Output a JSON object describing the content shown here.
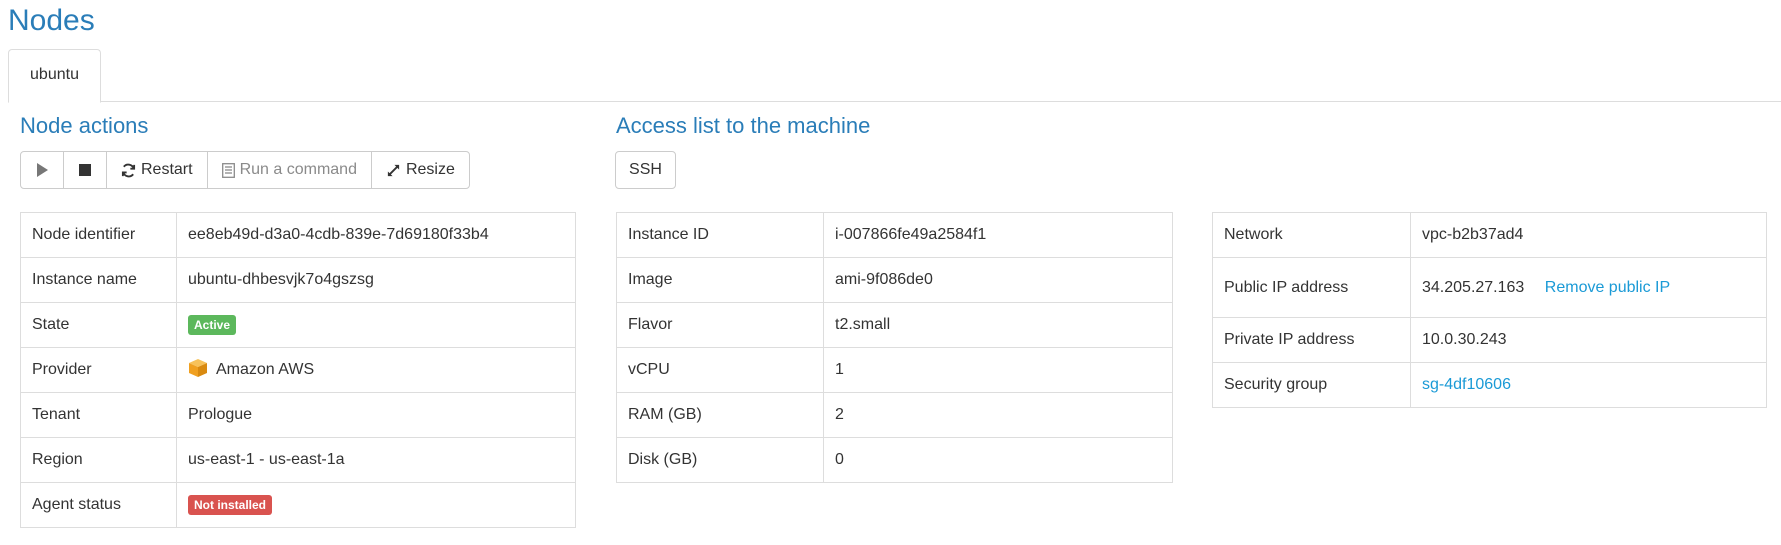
{
  "page": {
    "title": "Nodes"
  },
  "tabs": [
    {
      "label": "ubuntu"
    }
  ],
  "node_actions": {
    "title": "Node actions",
    "play_icon": "play-icon",
    "stop_icon": "stop-icon",
    "restart_label": "Restart",
    "run_command_label": "Run a command",
    "resize_label": "Resize"
  },
  "access": {
    "title": "Access list to the machine",
    "ssh_label": "SSH"
  },
  "node_table": [
    {
      "label": "Node identifier",
      "value": "ee8eb49d-d3a0-4cdb-839e-7d69180f33b4"
    },
    {
      "label": "Instance name",
      "value": "ubuntu-dhbesvjk7o4gszsg"
    },
    {
      "label": "State",
      "value": "Active",
      "color": "#5cb85c"
    },
    {
      "label": "Provider",
      "value": "Amazon AWS",
      "icon": "aws-icon"
    },
    {
      "label": "Tenant",
      "value": "Prologue"
    },
    {
      "label": "Region",
      "value": "us-east-1 - us-east-1a"
    },
    {
      "label": "Agent status",
      "value": "Not installed",
      "color": "#d9534f"
    }
  ],
  "instance_table": [
    {
      "label": "Instance ID",
      "value": "i-007866fe49a2584f1"
    },
    {
      "label": "Image",
      "value": "ami-9f086de0"
    },
    {
      "label": "Flavor",
      "value": "t2.small"
    },
    {
      "label": "vCPU",
      "value": "1"
    },
    {
      "label": "RAM (GB)",
      "value": "2"
    },
    {
      "label": "Disk (GB)",
      "value": "0"
    }
  ],
  "network_table": [
    {
      "label": "Network",
      "value": "vpc-b2b37ad4"
    },
    {
      "label": "Public IP address",
      "value": "34.205.27.163",
      "action": "Remove public IP"
    },
    {
      "label": "Private IP address",
      "value": "10.0.30.243"
    },
    {
      "label": "Security group",
      "value": "sg-4df10606"
    }
  ],
  "colors": {
    "accent": "#2a7db8",
    "link": "#1a9ad6",
    "active": "#5cb85c",
    "danger": "#d9534f"
  }
}
